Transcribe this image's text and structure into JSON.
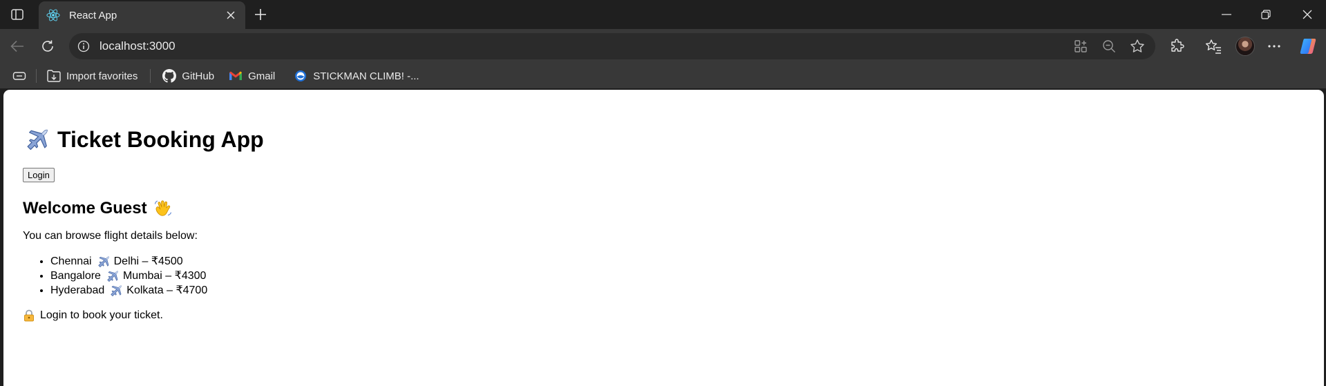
{
  "browser": {
    "tab": {
      "title": "React App",
      "favicon": "react-logo-icon"
    },
    "address_bar": {
      "url": "localhost:3000"
    },
    "bookmarks": [
      {
        "label": "Import favorites",
        "icon": "import-favorites-icon"
      },
      {
        "label": "GitHub",
        "icon": "github-icon"
      },
      {
        "label": "Gmail",
        "icon": "gmail-icon"
      },
      {
        "label": "STICKMAN CLIMB! -...",
        "icon": "stickman-icon"
      }
    ]
  },
  "page": {
    "title": "Ticket Booking App",
    "login_button": "Login",
    "welcome": "Welcome Guest",
    "intro": "You can browse flight details below:",
    "flights": [
      {
        "from": "Chennai",
        "to": "Delhi – ₹4500"
      },
      {
        "from": "Bangalore",
        "to": "Mumbai – ₹4300"
      },
      {
        "from": "Hyderabad",
        "to": "Kolkata – ₹4700"
      }
    ],
    "notice": "Login to book your ticket."
  },
  "colors": {
    "chrome_dark": "#1f1f1f",
    "chrome_toolbar": "#383838",
    "omnibox": "#2b2b2b",
    "react_accent": "#61dafb"
  }
}
